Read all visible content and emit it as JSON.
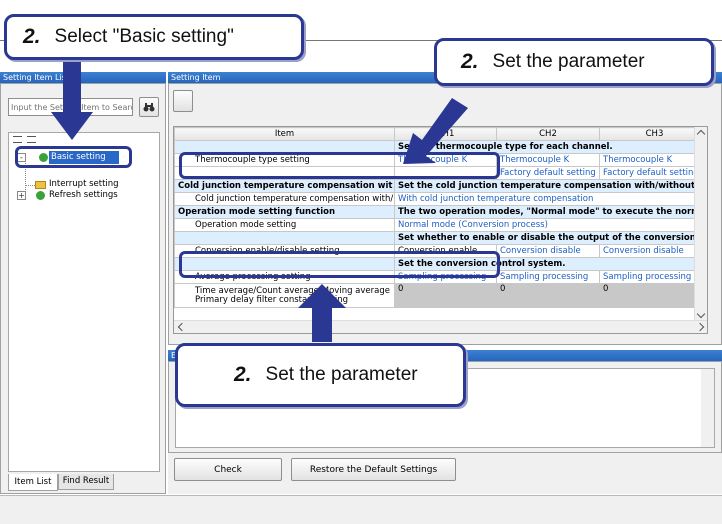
{
  "left_panel": {
    "title": "Setting Item List",
    "search_placeholder": "Input the Setting Item to Search",
    "tree": [
      {
        "label": "Basic setting",
        "selected": true
      },
      {
        "label": "Interrupt setting"
      },
      {
        "label": "Refresh settings"
      }
    ],
    "tabs": [
      "Item List",
      "Find Result"
    ]
  },
  "right_panel": {
    "title": "Setting Item",
    "columns": [
      "Item",
      "CH1",
      "CH2",
      "CH3"
    ],
    "rows": [
      {
        "type": "cat",
        "item": "",
        "span": "Set the thermocouple type for each channel."
      },
      {
        "type": "param",
        "item": "Thermocouple type setting",
        "ch1": "Thermocouple K",
        "ch2": "Thermocouple K",
        "ch3": "Thermocouple K"
      },
      {
        "type": "param",
        "item": "",
        "ch1": "",
        "ch2": "Factory default setting",
        "ch3": "Factory default setting"
      },
      {
        "type": "cat",
        "item": "Cold junction temperature compensation wit",
        "span": "Set the cold junction temperature compensation  with/without using th"
      },
      {
        "type": "param",
        "item": "Cold junction temperature compensation with/",
        "span": "With cold junction temperature compensation"
      },
      {
        "type": "cat",
        "item": "Operation mode setting function",
        "span": "The two operation modes, \"Normal mode\" to execute the normal ter"
      },
      {
        "type": "param",
        "item": "Operation mode setting",
        "span": "Normal mode (Conversion process)"
      },
      {
        "type": "cat",
        "item": "",
        "span": "Set whether to enable or disable the output of the conversion value."
      },
      {
        "type": "param",
        "item": "Conversion enable/disable setting",
        "ch1": "Conversion enable",
        "ch2": "Conversion disable",
        "ch3": "Conversion disable"
      },
      {
        "type": "cat",
        "item": "",
        "span": "Set the conversion control system."
      },
      {
        "type": "param",
        "item": "Average processing setting",
        "ch1": "Sampling processing",
        "ch2": "Sampling processing",
        "ch3": "Sampling processing"
      },
      {
        "type": "param2",
        "item": "Time average/Count average/Moving average",
        "item2": "Primary delay filter constant setting",
        "ch1": "0",
        "ch2": "0",
        "ch3": "0"
      }
    ]
  },
  "explanation": {
    "title": "Explanation"
  },
  "buttons": {
    "check": "Check",
    "restore": "Restore the Default Settings"
  },
  "callouts": {
    "top_left": {
      "num": "2.",
      "text": "Select \"Basic setting\""
    },
    "top_right": {
      "num": "2.",
      "text": "Set the parameter"
    },
    "bottom": {
      "num": "2.",
      "text": "Set the parameter"
    }
  },
  "colors": {
    "accent": "#2a3893",
    "titlebar": "#2466bd",
    "value_text": "#1d5fc4"
  }
}
